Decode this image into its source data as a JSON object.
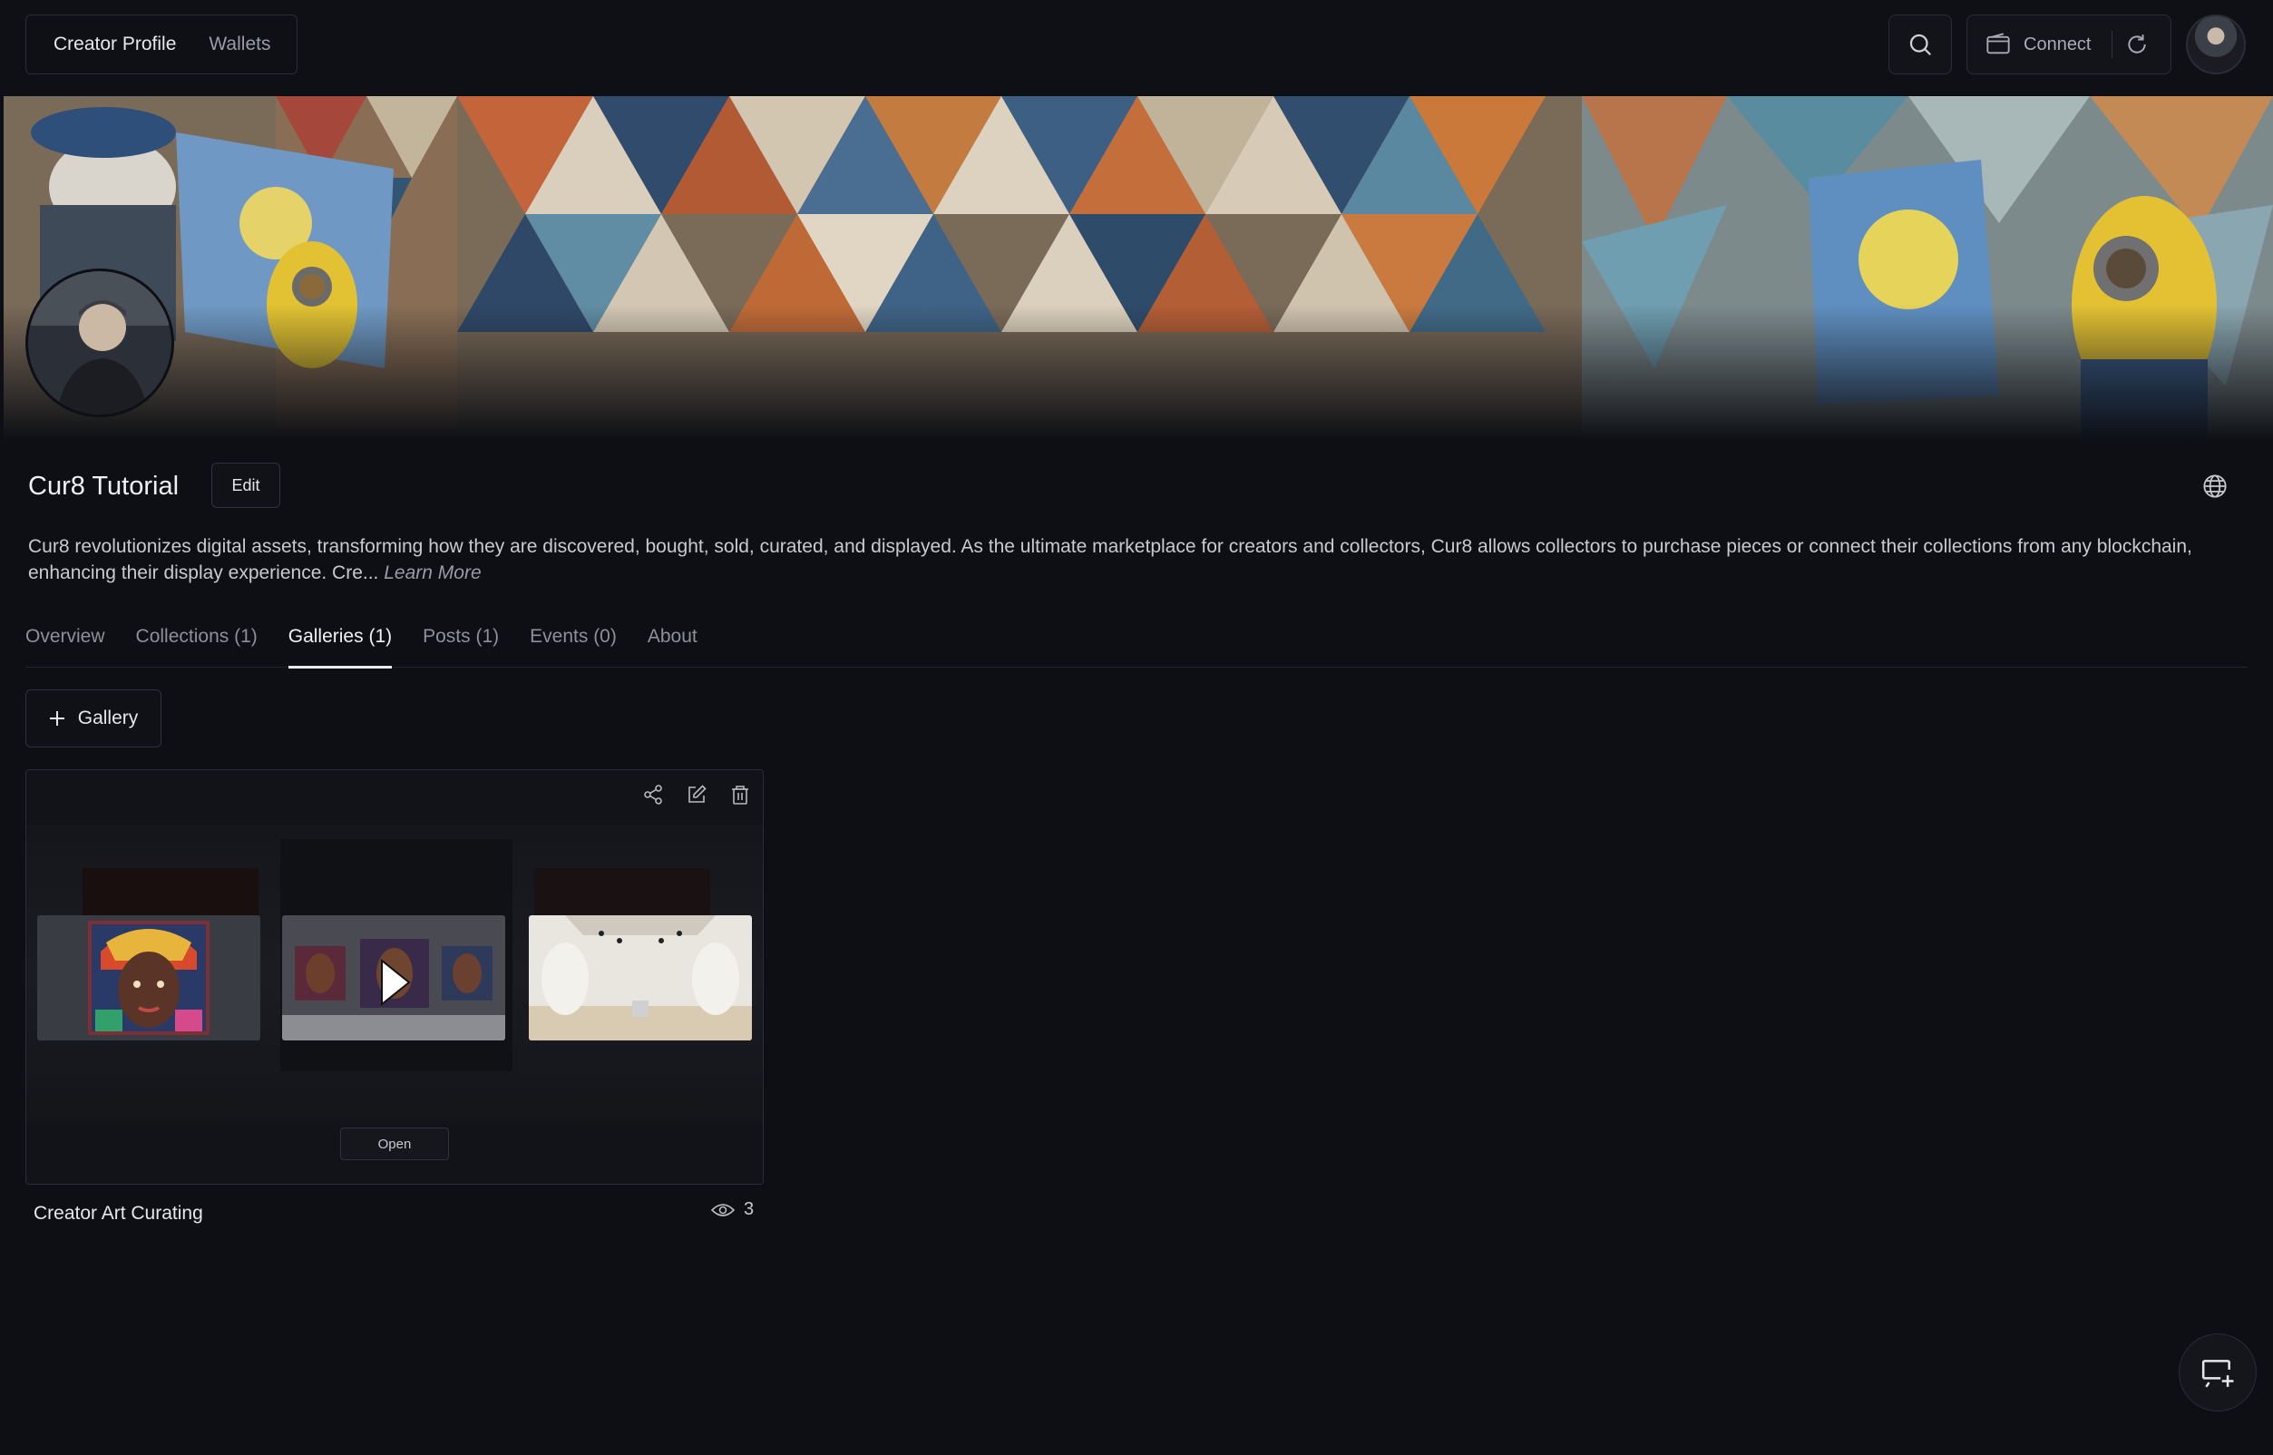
{
  "topbar": {
    "nav": [
      "Creator Profile",
      "Wallets"
    ],
    "connect_label": "Connect"
  },
  "profile": {
    "name": "Cur8 Tutorial",
    "edit_label": "Edit",
    "bio": "Cur8 revolutionizes digital assets, transforming how they are discovered, bought, sold, curated, and displayed. As the ultimate marketplace for creators and collectors, Cur8 allows collectors to purchase pieces or connect their collections from any blockchain, enhancing their display experience. Cre...",
    "learn_more": "Learn More"
  },
  "tabs": [
    {
      "label": "Overview"
    },
    {
      "label": "Collections (1)"
    },
    {
      "label": "Galleries (1)"
    },
    {
      "label": "Posts (1)"
    },
    {
      "label": "Events (0)"
    },
    {
      "label": "About"
    }
  ],
  "active_tab": "Galleries (1)",
  "add_gallery_label": "Gallery",
  "gallery": {
    "title": "Creator Art Curating",
    "open_label": "Open",
    "views": "3"
  },
  "icons": {
    "search": "search-icon",
    "wallet": "wallet-icon",
    "refresh": "refresh-icon",
    "globe": "globe-icon",
    "share": "share-icon",
    "edit": "edit-icon",
    "delete": "trash-icon",
    "eye": "eye-icon",
    "plus": "plus-icon",
    "cast": "cast-icon"
  }
}
